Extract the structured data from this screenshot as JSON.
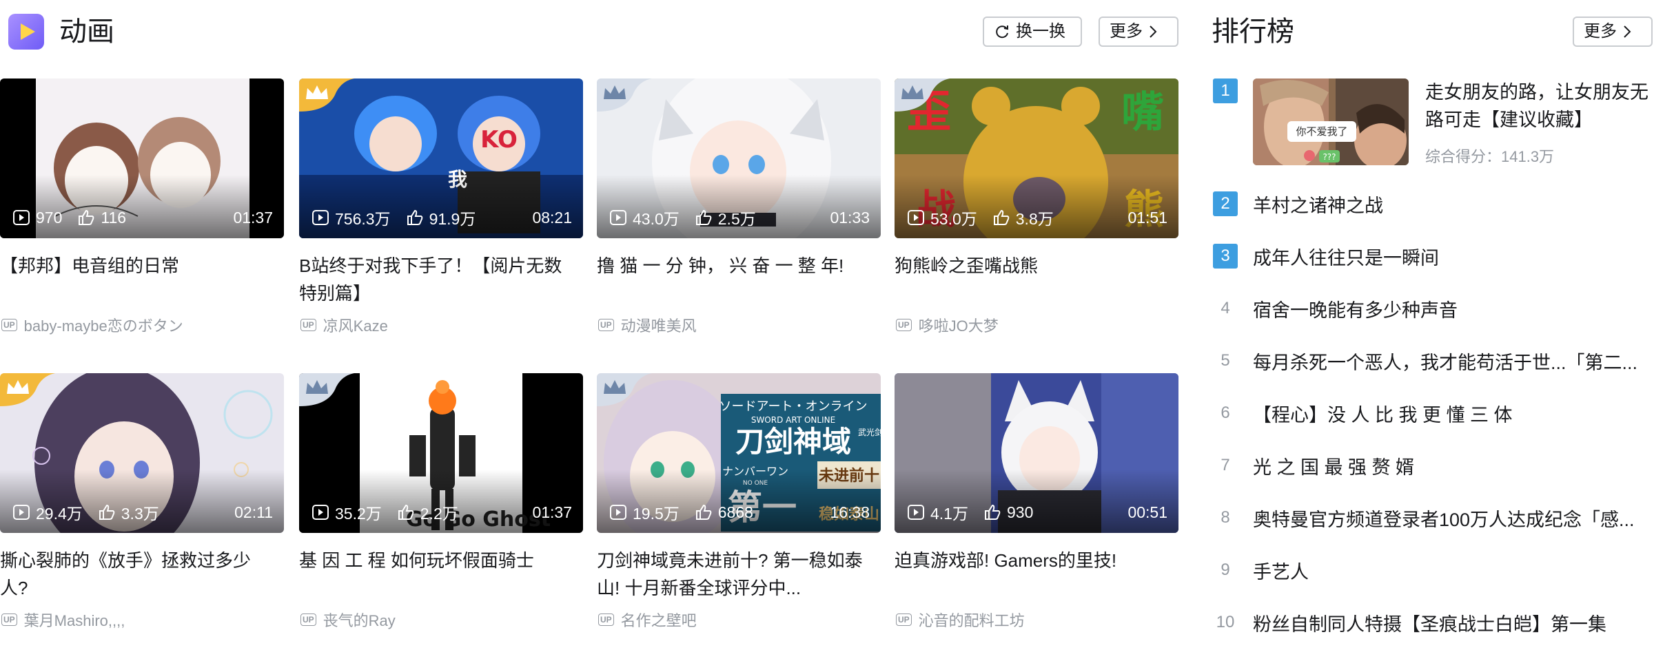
{
  "section": {
    "title": "动画",
    "refresh_label": "换一换",
    "more_label": "更多"
  },
  "videos": [
    {
      "title": "【邦邦】电音组的日常",
      "plays": "970",
      "likes": "116",
      "duration": "01:37",
      "uploader": "baby-maybe恋のボタン",
      "crown": "none"
    },
    {
      "title": "B站终于对我下手了！【阅片无数特别篇】",
      "plays": "756.3万",
      "likes": "91.9万",
      "duration": "08:21",
      "uploader": "凉风Kaze",
      "crown": "gold"
    },
    {
      "title": "撸 猫 一 分 钟， 兴 奋 一 整 年!",
      "plays": "43.0万",
      "likes": "2.5万",
      "duration": "01:33",
      "uploader": "动漫唯美风",
      "crown": "silver"
    },
    {
      "title": "狗熊岭之歪嘴战熊",
      "plays": "53.0万",
      "likes": "3.8万",
      "duration": "01:51",
      "uploader": "哆啦JO大梦",
      "crown": "silver"
    },
    {
      "title": "撕心裂肺的《放手》拯救过多少人?",
      "plays": "29.4万",
      "likes": "3.3万",
      "duration": "02:11",
      "uploader": "葉月Mashiro,,,,",
      "crown": "gold"
    },
    {
      "title": "基 因 工 程 如何玩坏假面骑士",
      "plays": "35.2万",
      "likes": "2.2万",
      "duration": "01:37",
      "uploader": "丧气的Ray",
      "crown": "silver"
    },
    {
      "title": "刀剑神域竟未进前十? 第一稳如泰山! 十月新番全球评分中...",
      "plays": "19.5万",
      "likes": "6868",
      "duration": "16:38",
      "uploader": "名作之壁吧",
      "crown": "silver"
    },
    {
      "title": "迫真游戏部! Gamers的里技!",
      "plays": "4.1万",
      "likes": "930",
      "duration": "00:51",
      "uploader": "沁音的配料工坊",
      "crown": "none"
    }
  ],
  "thumb_text": {
    "t2_ko": "KO",
    "t2_wo": "我",
    "t4_left_top": "歪",
    "t4_left_bottom": "战",
    "t4_right_top": "嘴",
    "t4_right_bottom": "熊",
    "t6_caption": "Go Go Ghost",
    "t7_jp": "ソードアート・オンライン",
    "t7_en": "SWORD ART ONLINE",
    "t7_cn": "刀剑神域",
    "t7_side": "武光剑",
    "t7_no1_jp": "ナンバーワン",
    "t7_no1_en": "NO ONE",
    "t7_no1_cn": "第一",
    "t7_sub1": "未进前十",
    "t7_sub2": "稳如泰山",
    "rank_bubble": "你不爱我了",
    "rank_q": "???"
  },
  "up_tag": "UP",
  "ranking": {
    "title": "排行榜",
    "more_label": "更多",
    "featured": {
      "rank": "1",
      "title": "走女朋友的路，让女朋友无路可走【建议收藏】",
      "score": "综合得分：141.3万"
    },
    "items": [
      {
        "rank": "2",
        "title": "羊村之诸神之战"
      },
      {
        "rank": "3",
        "title": "成年人往往只是一瞬间"
      },
      {
        "rank": "4",
        "title": "宿舍一晚能有多少种声音"
      },
      {
        "rank": "5",
        "title": "每月杀死一个恶人，我才能苟活于世...「第二..."
      },
      {
        "rank": "6",
        "title": "【程心】没 人 比 我 更 懂 三 体"
      },
      {
        "rank": "7",
        "title": "光 之 国 最 强 赘 婿"
      },
      {
        "rank": "8",
        "title": "奥特曼官方频道登录者100万人达成纪念「感..."
      },
      {
        "rank": "9",
        "title": "手艺人"
      },
      {
        "rank": "10",
        "title": "粉丝自制同人特摄【圣痕战士白皑】第一集"
      }
    ]
  },
  "colors": {
    "accent_blue": "#3d9ee0",
    "crown_gold": "#f3b93a",
    "crown_silver": "#d6dde8",
    "text_muted": "#9499a0"
  }
}
